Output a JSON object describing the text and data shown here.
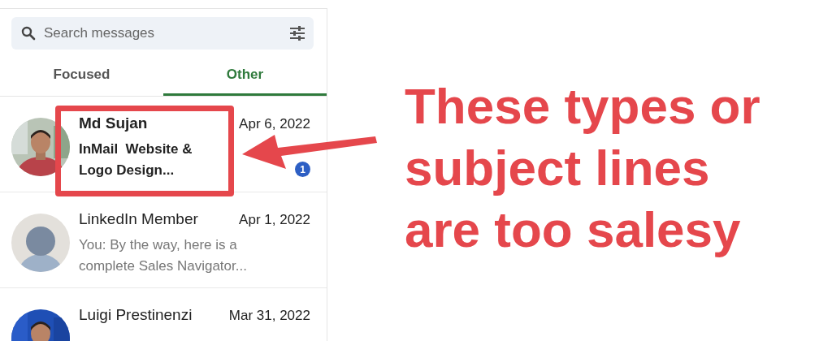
{
  "search": {
    "placeholder": "Search messages"
  },
  "tabs": [
    {
      "label": "Focused",
      "selected": false
    },
    {
      "label": "Other",
      "selected": true
    }
  ],
  "conversations": [
    {
      "name": "Md Sujan",
      "date": "Apr 6, 2022",
      "preview": "InMail  Website & Logo Design...",
      "unread": true,
      "badge": "1"
    },
    {
      "name": "LinkedIn Member",
      "date": "Apr 1, 2022",
      "preview": "You: By the way, here is a complete Sales Navigator...",
      "unread": false,
      "kind": "placeholder"
    },
    {
      "name": "Luigi Prestinenzi",
      "date": "Mar 31, 2022",
      "unread": false
    }
  ],
  "annotation": {
    "text": "These types or subject lines are too salesy",
    "color": "#e5474c"
  }
}
